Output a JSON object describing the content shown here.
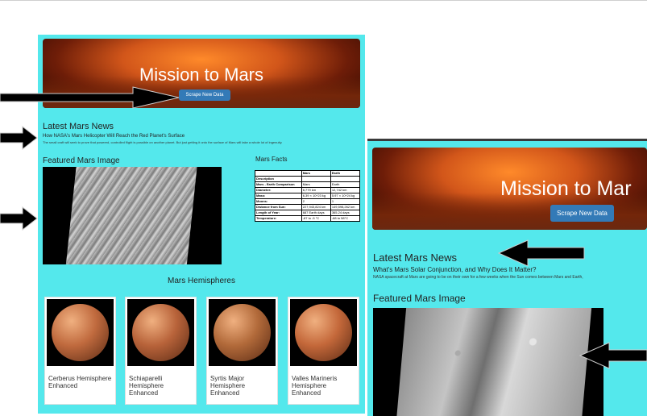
{
  "left_page": {
    "title": "Mission to Mars",
    "scrape_button": "Scrape New Data",
    "news_heading": "Latest Mars News",
    "news_title": "How NASA's Mars Helicopter Will Reach the Red Planet's Surface",
    "news_paragraph": "The small craft will seek to prove that powered, controlled flight is possible on another planet. But just getting it onto the surface of Mars will take a whole lot of ingenuity.",
    "featured_heading": "Featured Mars Image",
    "facts_heading": "Mars Facts",
    "facts_table": [
      [
        "",
        "Mars",
        "Earth"
      ],
      [
        "Description",
        "",
        ""
      ],
      [
        "Mars - Earth Comparison",
        "Mars",
        "Earth"
      ],
      [
        "Diameter:",
        "6,779 km",
        "12,742 km"
      ],
      [
        "Mass:",
        "6.39 × 10^23 kg",
        "5.97 × 10^24 kg"
      ],
      [
        "Moons:",
        "2",
        "1"
      ],
      [
        "Distance from Sun:",
        "227,943,824 km",
        "149,598,262 km"
      ],
      [
        "Length of Year:",
        "687 Earth days",
        "365.24 days"
      ],
      [
        "Temperature:",
        "-87 to -5 °C",
        "-88 to 58°C"
      ]
    ],
    "hemispheres_heading": "Mars Hemispheres",
    "hemispheres": [
      {
        "label": "Cerberus Hemisphere Enhanced",
        "color": "#c06a3e"
      },
      {
        "label": "Schiaparelli Hemisphere Enhanced",
        "color": "#b8633a"
      },
      {
        "label": "Syrtis Major Hemisphere Enhanced",
        "color": "#b26a3a"
      },
      {
        "label": "Valles Marineris Hemisphere Enhanced",
        "color": "#c4683a"
      }
    ]
  },
  "right_page": {
    "title": "Mission to Mar",
    "scrape_button": "Scrape New Data",
    "news_heading": "Latest Mars News",
    "news_title": "What's Mars Solar Conjunction, and Why Does It Matter?",
    "news_paragraph": "NASA spacecraft at Mars are going to be on their own for a few weeks when the Sun comes between Mars and Earth,",
    "featured_heading": "Featured Mars Image"
  },
  "colors": {
    "page_bg": "#54e8ec",
    "button": "#337ab7",
    "arrow": "#000000"
  }
}
